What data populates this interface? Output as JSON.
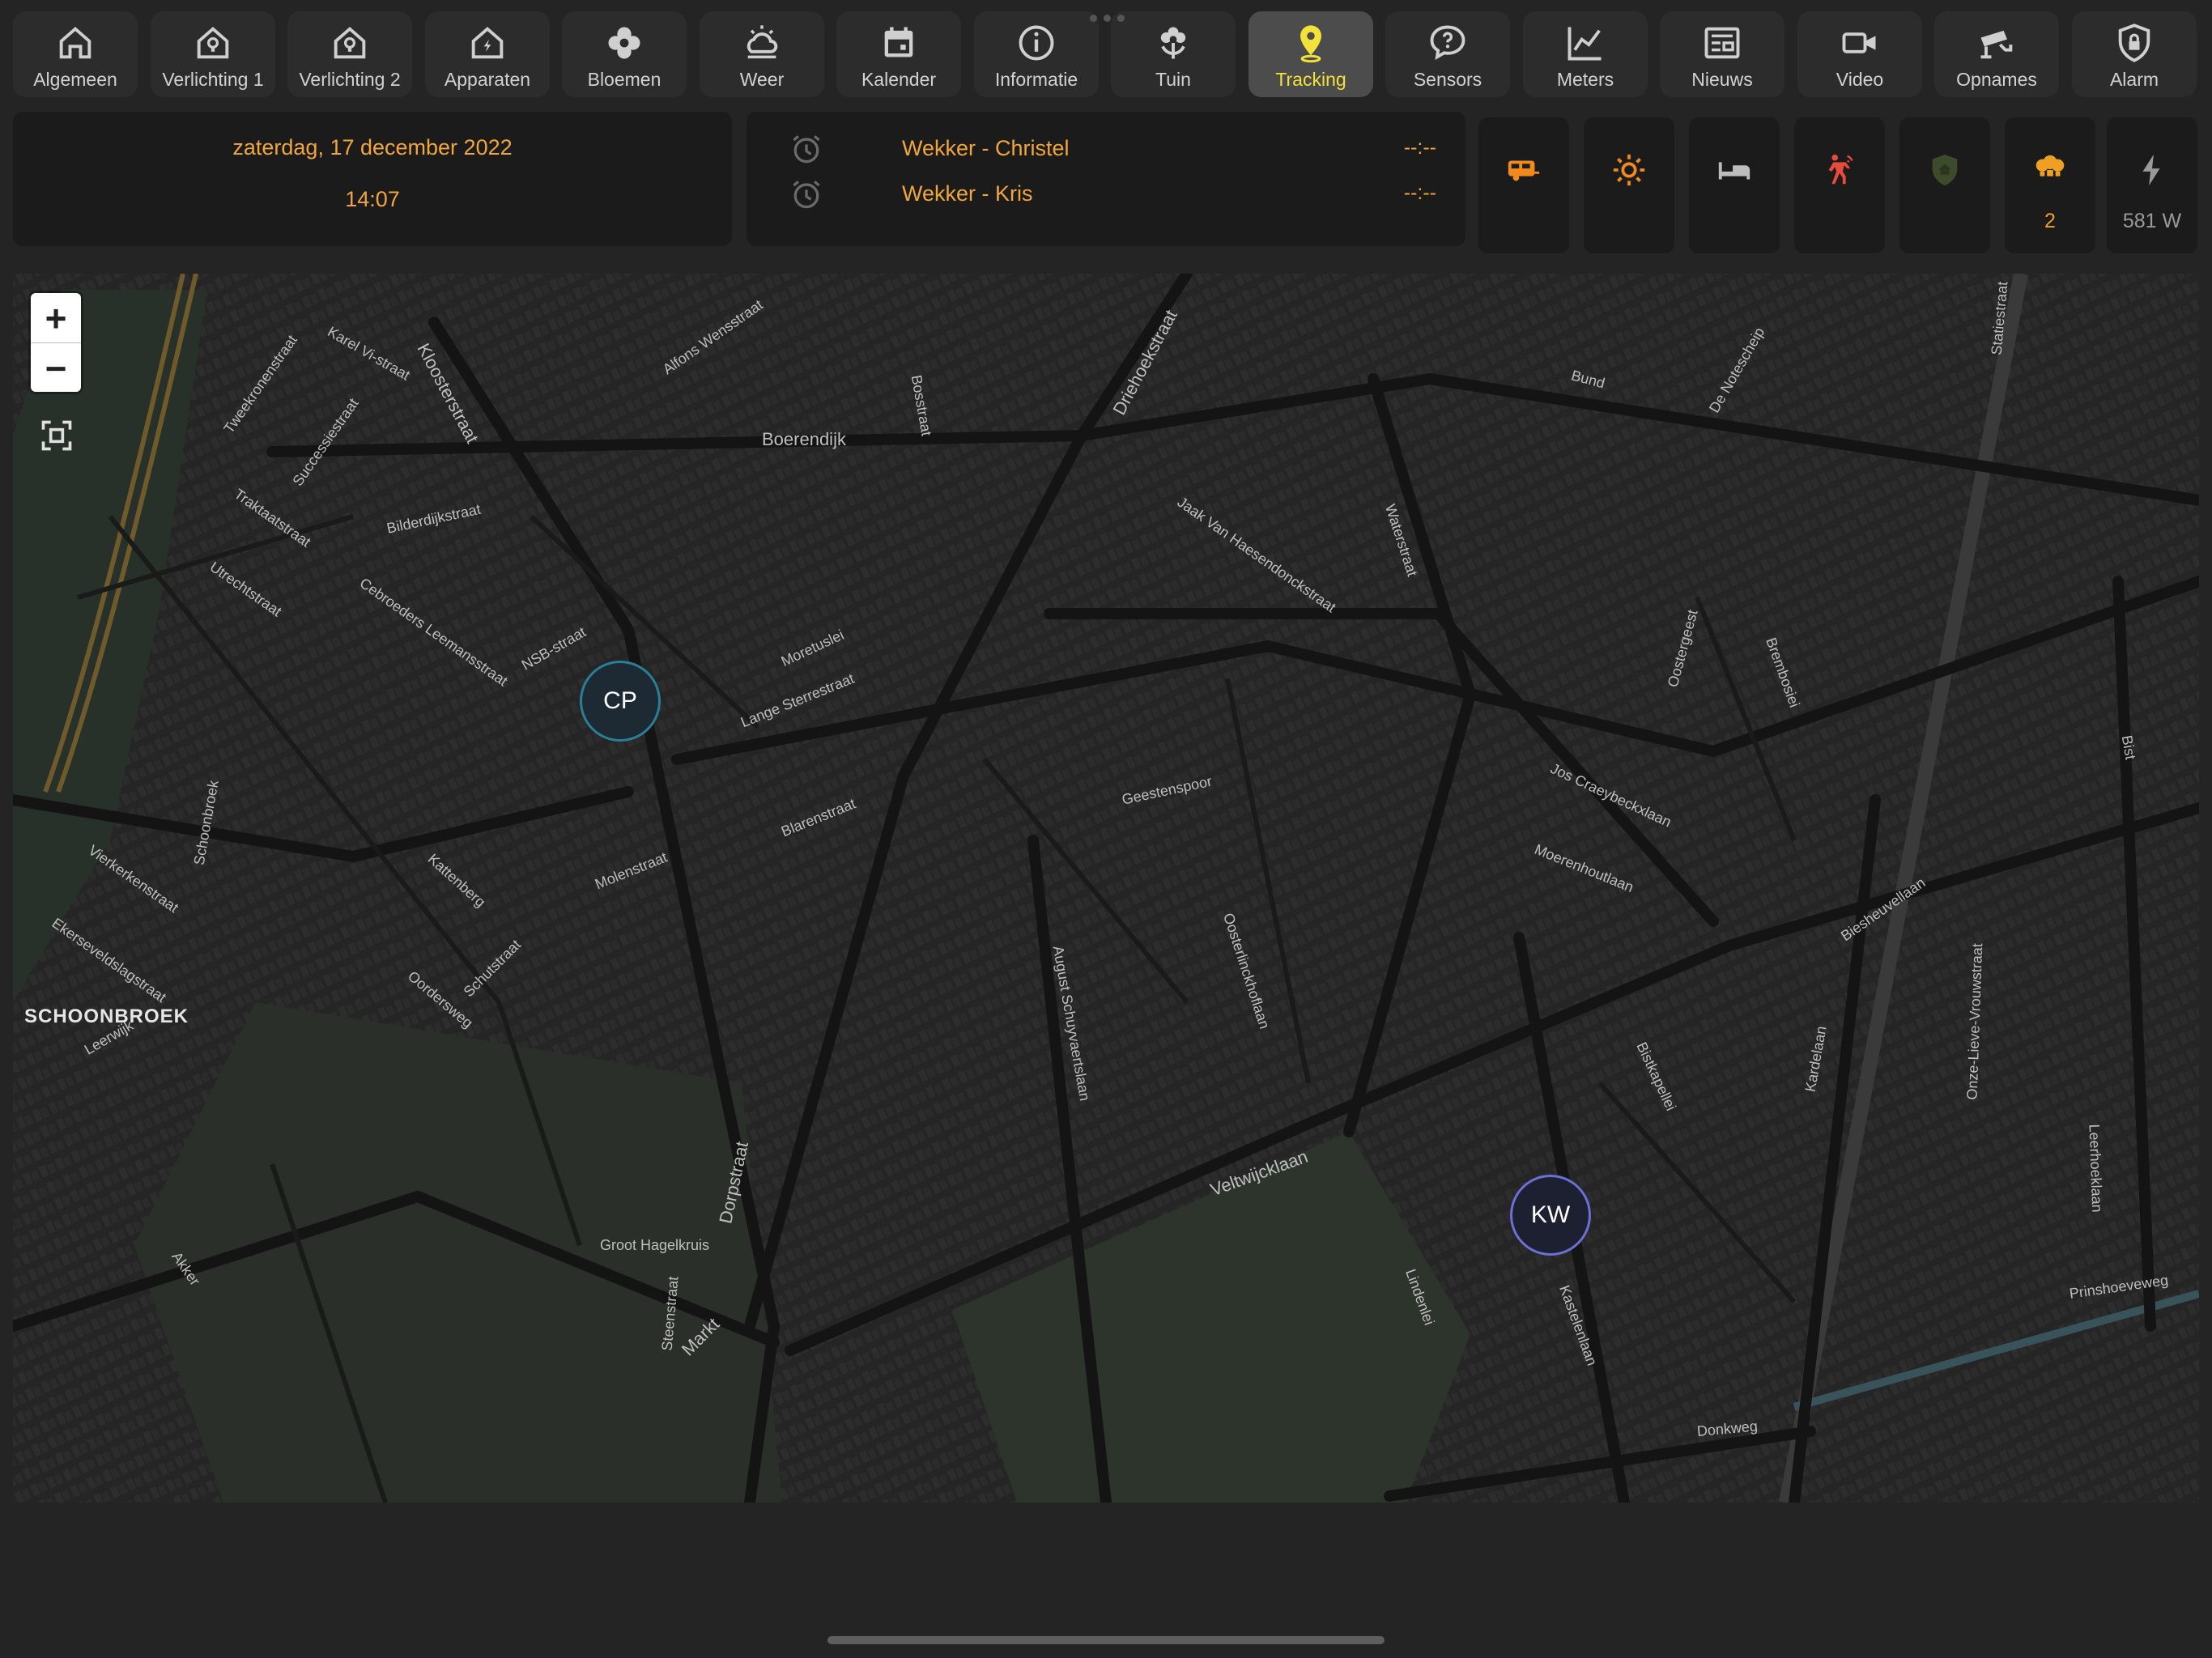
{
  "tabs": [
    {
      "label": "Algemeen",
      "icon": "home-icon"
    },
    {
      "label": "Verlichting 1",
      "icon": "home-light-icon"
    },
    {
      "label": "Verlichting 2",
      "icon": "home-light-icon"
    },
    {
      "label": "Apparaten",
      "icon": "home-power-icon"
    },
    {
      "label": "Bloemen",
      "icon": "flower-icon"
    },
    {
      "label": "Weer",
      "icon": "weather-icon"
    },
    {
      "label": "Kalender",
      "icon": "calendar-icon"
    },
    {
      "label": "Informatie",
      "icon": "info-icon"
    },
    {
      "label": "Tuin",
      "icon": "garden-icon"
    },
    {
      "label": "Tracking",
      "icon": "map-pin-icon",
      "active": true
    },
    {
      "label": "Sensors",
      "icon": "chat-question-icon"
    },
    {
      "label": "Meters",
      "icon": "chart-line-icon"
    },
    {
      "label": "Nieuws",
      "icon": "newspaper-icon"
    },
    {
      "label": "Video",
      "icon": "video-camera-icon"
    },
    {
      "label": "Opnames",
      "icon": "cctv-icon"
    },
    {
      "label": "Alarm",
      "icon": "shield-lock-icon"
    }
  ],
  "header": {
    "date": "zaterdag, 17 december 2022",
    "time": "14:07"
  },
  "alarms": [
    {
      "name": "Wekker - Christel",
      "time": "--:--"
    },
    {
      "name": "Wekker - Kris",
      "time": "--:--"
    }
  ],
  "status_buttons": [
    {
      "icon": "caravan-icon",
      "color": "#f08a1c",
      "value": ""
    },
    {
      "icon": "sun-icon",
      "color": "#f08a1c",
      "value": ""
    },
    {
      "icon": "bed-icon",
      "color": "#bdbdbd",
      "value": ""
    },
    {
      "icon": "motion-sensor-icon",
      "color": "#e84b3c",
      "value": ""
    },
    {
      "icon": "shield-home-icon",
      "color": "#3e4a2c",
      "value": ""
    },
    {
      "icon": "lightbulb-group-icon",
      "color": "#f0a020",
      "value": "2"
    },
    {
      "icon": "flash-icon",
      "color": "#9a9a9a",
      "value": "581 W"
    }
  ],
  "map": {
    "zoom_in": "+",
    "zoom_out": "−",
    "markers": [
      {
        "label": "CP"
      },
      {
        "label": "KW"
      }
    ],
    "district": "SCHOONBROEK",
    "streets": [
      "Kloosterstraat",
      "Boerendijk",
      "Driehoekstraat",
      "Bund",
      "Jaak Van Haesendonckstraat",
      "Waterstraat",
      "De Notescheip",
      "Statiestraat",
      "Moretuslei",
      "Lange Sterrestraat",
      "Blarenstraat",
      "Geestenspoor",
      "Molenstraat",
      "Kattenberg",
      "Oordersweg",
      "Schutstraat",
      "August Schuyvaertslaan",
      "Oosterlinckhoflaan",
      "Jos Craeybeckxlaan",
      "Moerenhoutlaan",
      "Veltwijcklaan",
      "Biesheuvellaan",
      "Dorpstraat",
      "Markt",
      "Groot Hagelkruis",
      "Steenstraat",
      "Donkweg",
      "Prinshoeveweg",
      "Kastelenlaan",
      "Lindenlei",
      "Bistkapellei",
      "Kardelaan",
      "Onze-Lieve-Vrouwstraat",
      "Leerhoeklaan",
      "Akker",
      "Schoonbroek",
      "Vierkerkenstraat",
      "Ekerseveldslagstraat",
      "Leerwijk",
      "Bilderdijkstraat",
      "NSB-straat",
      "Cebroeders Leemansstraat",
      "Utrechtstraat",
      "Traktaatstraat",
      "Successiestraat",
      "Tweekronenstraat",
      "Karel Vi-straat",
      "Alfons Wensstraat",
      "Bosstraat",
      "Brembosiei",
      "Oostergeest",
      "Bist"
    ]
  }
}
